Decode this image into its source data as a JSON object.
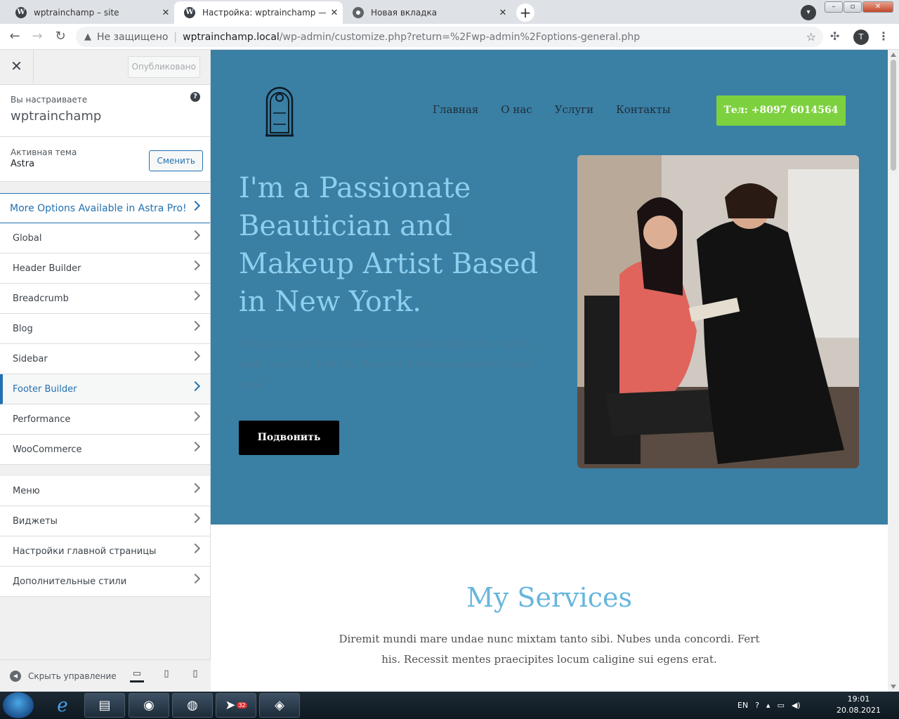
{
  "browser": {
    "tabs": [
      {
        "title": "wptrainchamp – site",
        "icon": "wordpress-icon",
        "active": false
      },
      {
        "title": "Настройка: wptrainchamp — site",
        "icon": "wordpress-icon",
        "active": true
      },
      {
        "title": "Новая вкладка",
        "icon": "chrome-icon",
        "active": false
      }
    ],
    "new_tab": "+",
    "security_label": "Не защищено",
    "url_host": "wptrainchamp.local",
    "url_path": "/wp-admin/customize.php?return=%2Fwp-admin%2Foptions-general.php",
    "profile_initial": "T"
  },
  "sidebar": {
    "publish_label": "Опубликовано",
    "customizing_label": "Вы настраиваете",
    "site_name": "wptrainchamp",
    "active_theme_label": "Активная тема",
    "theme_name": "Astra",
    "change_label": "Сменить",
    "astra_pro": "More Options Available in Astra Pro!",
    "sections_a": [
      {
        "label": "Global"
      },
      {
        "label": "Header Builder"
      },
      {
        "label": "Breadcrumb"
      },
      {
        "label": "Blog"
      },
      {
        "label": "Sidebar"
      },
      {
        "label": "Footer Builder"
      },
      {
        "label": "Performance"
      },
      {
        "label": "WooCommerce"
      }
    ],
    "sections_b": [
      {
        "label": "Меню"
      },
      {
        "label": "Виджеты"
      },
      {
        "label": "Настройки главной страницы"
      },
      {
        "label": "Дополнительные стили"
      }
    ],
    "active_section": "Footer Builder",
    "hide_controls": "Скрыть управление"
  },
  "preview": {
    "nav": [
      "Главная",
      "О нас",
      "Услуги",
      "Контакты"
    ],
    "phone_button": "Тел: +8097 6014564",
    "hero_title": "I'm a Passionate Beautician and Makeup Artist Based in New York.",
    "hero_text": "Diremit mundi mare undae nunc mixtam tanto sibi. Nubes unda concordi. Fert his. Recessit mentes praecipites locum gens.",
    "hero_button": "Подвонить",
    "services_title": "My Services",
    "services_text": "Diremit mundi mare undae nunc mixtam tanto sibi. Nubes unda concordi. Fert his. Recessit mentes praecipites locum caligine sui egens erat.",
    "colors": {
      "hero_bg": "#3a7fa4",
      "accent": "#7dd13f",
      "title": "#8ecfee"
    }
  },
  "taskbar": {
    "lang": "EN",
    "time": "19:01",
    "date": "20.08.2021",
    "telegram_badge": "32"
  }
}
